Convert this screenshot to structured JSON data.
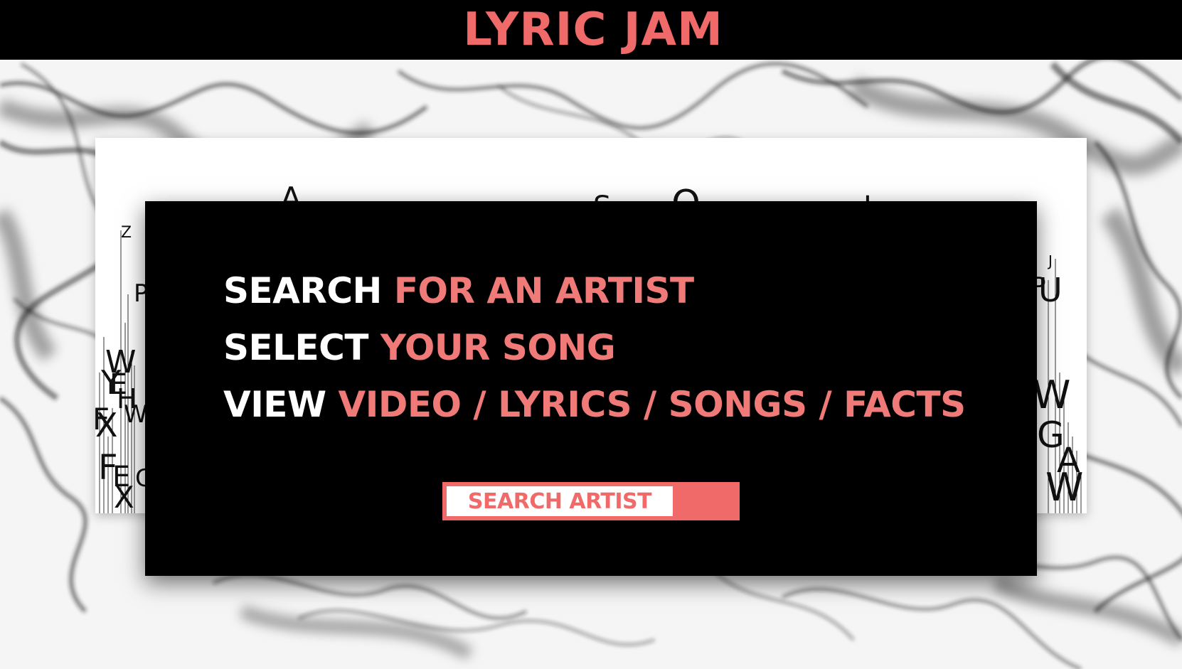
{
  "header": {
    "title": "LYRIC JAM"
  },
  "instructions": [
    {
      "white": "SEARCH",
      "pink": "FOR AN ARTIST"
    },
    {
      "white": "SELECT",
      "pink": "YOUR SONG"
    },
    {
      "white": "VIEW",
      "pink": "VIDEO / LYRICS / SONGS / FACTS"
    }
  ],
  "search_button": {
    "label": "SEARCH ARTIST"
  },
  "colors": {
    "accent": "#f06a6a",
    "accent_text": "#f07a78",
    "header_bg": "#000000",
    "panel_bg": "#000000",
    "card_bg": "#ffffff"
  }
}
